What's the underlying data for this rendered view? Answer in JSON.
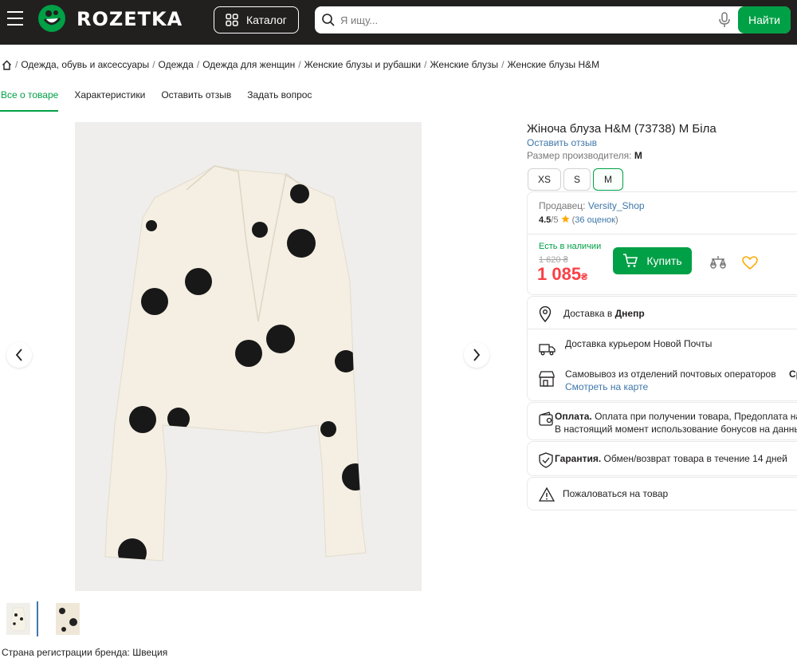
{
  "header": {
    "logo_text": "ROZETKA",
    "catalog_label": "Каталог",
    "search_placeholder": "Я ищу...",
    "search_button": "Найти"
  },
  "breadcrumbs": [
    "Одежда, обувь и аксессуары",
    "Одежда",
    "Одежда для женщин",
    "Женские блузы и рубашки",
    "Женские блузы",
    "Женские блузы H&M"
  ],
  "tabs": [
    "Все о товаре",
    "Характеристики",
    "Оставить отзыв",
    "Задать вопрос"
  ],
  "product": {
    "title": "Жіноча блуза H&M (73738) M Біла",
    "review_link": "Оставить отзыв",
    "size_label": "Размер производителя:",
    "size_value": "M",
    "sizes": [
      "XS",
      "S",
      "M"
    ],
    "selected_size": "M",
    "country": "Страна регистрации бренда: Швеция"
  },
  "seller": {
    "label": "Продавец:",
    "name": "Versity_Shop",
    "rating": "4.5",
    "rating_of": "/5",
    "reviews": "36 оценок",
    "stock": "Есть в наличии",
    "old_price": "1 620 ₴",
    "price": "1 085",
    "currency": "₴",
    "buy_label": "Купить"
  },
  "delivery": {
    "label": "Доставка в",
    "city": "Днепр",
    "courier": "Доставка курьером Новой Почты",
    "pickup": "Самовывоз из отделений почтовых операторов",
    "pickup_extra": "Ср",
    "map_link": "Смотреть на карте"
  },
  "payment": {
    "title": "Оплата.",
    "text1": "Оплата при получении товара, Предоплата на ка",
    "text2": "В настоящий момент использование бонусов на данный"
  },
  "guarantee": {
    "title": "Гарантия.",
    "text": "Обмен/возврат товара в течение 14 дней"
  },
  "complaint": "Пожаловаться на товар",
  "colors": {
    "brand_green": "#00a046",
    "header_dark": "#221f1f",
    "link_blue": "#3e77aa",
    "price_red": "#f84147",
    "star": "#ffa900"
  }
}
